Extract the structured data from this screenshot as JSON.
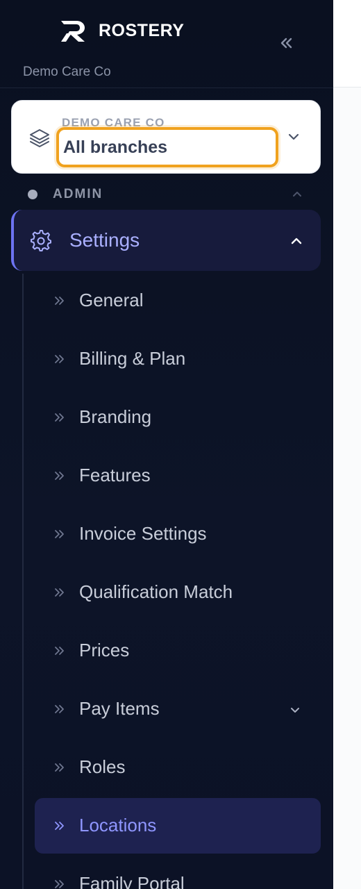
{
  "brand": {
    "name": "ROSTERY",
    "logo_icon": "rostery-r-logo"
  },
  "collapse_icon": "double-chevron-left-icon",
  "org_subtitle": "Demo Care Co",
  "branch_switcher": {
    "org_label": "DEMO CARE CO",
    "selected_branch": "All branches",
    "icon": "layers-icon",
    "highlight_color": "#f0a21e"
  },
  "section": {
    "label": "ADMIN",
    "state": "expanded"
  },
  "settings": {
    "label": "Settings",
    "icon": "gear-icon",
    "expanded": true,
    "accent": "#6d73f2"
  },
  "sub_items": [
    {
      "label": "General"
    },
    {
      "label": "Billing & Plan"
    },
    {
      "label": "Branding"
    },
    {
      "label": "Features"
    },
    {
      "label": "Invoice Settings"
    },
    {
      "label": "Qualification Match"
    },
    {
      "label": "Prices"
    },
    {
      "label": "Pay Items",
      "has_submenu": true
    },
    {
      "label": "Roles"
    },
    {
      "label": "Locations",
      "active": true
    },
    {
      "label": "Family Portal"
    }
  ],
  "colors": {
    "sidebar_bg": "#0b1122",
    "active_text": "#8f96ff",
    "text": "#c8cdd9"
  }
}
